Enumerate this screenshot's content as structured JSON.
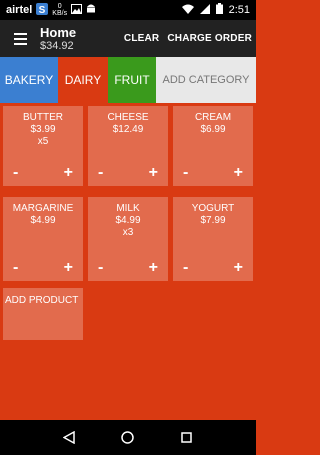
{
  "status_bar": {
    "carrier": "airtel",
    "data_rate_value": "0",
    "data_rate_unit": "KB/s",
    "time": "2:51"
  },
  "app_bar": {
    "title": "Home",
    "subtitle": "$34.92",
    "clear_label": "CLEAR",
    "charge_label": "CHARGE ORDER"
  },
  "tabs": [
    {
      "label": "BAKERY",
      "color": "#3b7fd1"
    },
    {
      "label": "DAIRY",
      "color": "#d93a12"
    },
    {
      "label": "FRUIT",
      "color": "#3a9a1c"
    },
    {
      "label": "ADD CATEGORY",
      "color": "#e8e8e8"
    }
  ],
  "products": [
    {
      "name": "BUTTER",
      "price": "$3.99",
      "qty": "x5",
      "minus": "-",
      "plus": "+"
    },
    {
      "name": "CHEESE",
      "price": "$12.49",
      "qty": "",
      "minus": "-",
      "plus": "+"
    },
    {
      "name": "CREAM",
      "price": "$6.99",
      "qty": "",
      "minus": "-",
      "plus": "+"
    },
    {
      "name": "MARGARINE",
      "price": "$4.99",
      "qty": "",
      "minus": "-",
      "plus": "+"
    },
    {
      "name": "MILK",
      "price": "$4.99",
      "qty": "x3",
      "minus": "-",
      "plus": "+"
    },
    {
      "name": "YOGURT",
      "price": "$7.99",
      "qty": "",
      "minus": "-",
      "plus": "+"
    }
  ],
  "add_product_label": "ADD PRODUCT",
  "colors": {
    "background": "#d93a12",
    "app_bar": "#222222"
  }
}
